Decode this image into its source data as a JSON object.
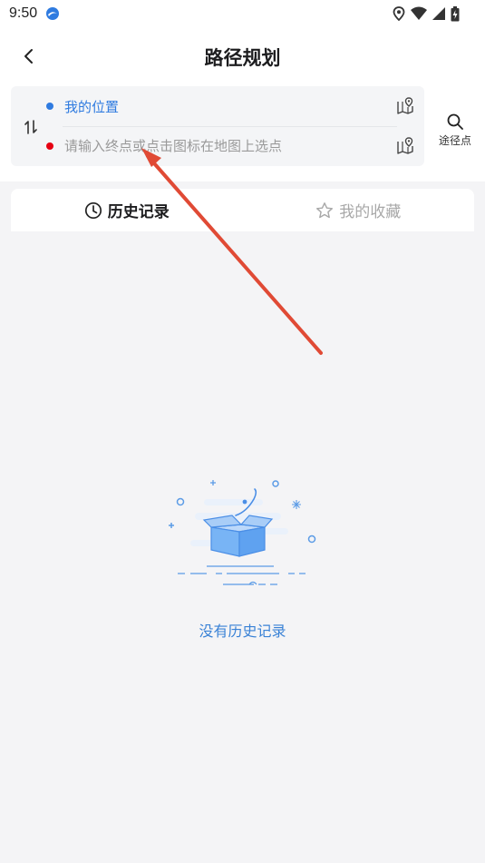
{
  "status_bar": {
    "time": "9:50"
  },
  "nav": {
    "title": "路径规划"
  },
  "route": {
    "start_label": "我的位置",
    "end_placeholder": "请输入终点或点击图标在地图上选点",
    "end_value": ""
  },
  "waypoint": {
    "label": "途径点"
  },
  "tabs": [
    {
      "label": "历史记录",
      "active": true
    },
    {
      "label": "我的收藏",
      "active": false
    }
  ],
  "empty_state": {
    "message": "没有历史记录"
  },
  "colors": {
    "accent": "#2f7be0",
    "start_dot": "#2f7be0",
    "end_dot": "#e60012",
    "annotation_arrow": "#e04a35"
  }
}
